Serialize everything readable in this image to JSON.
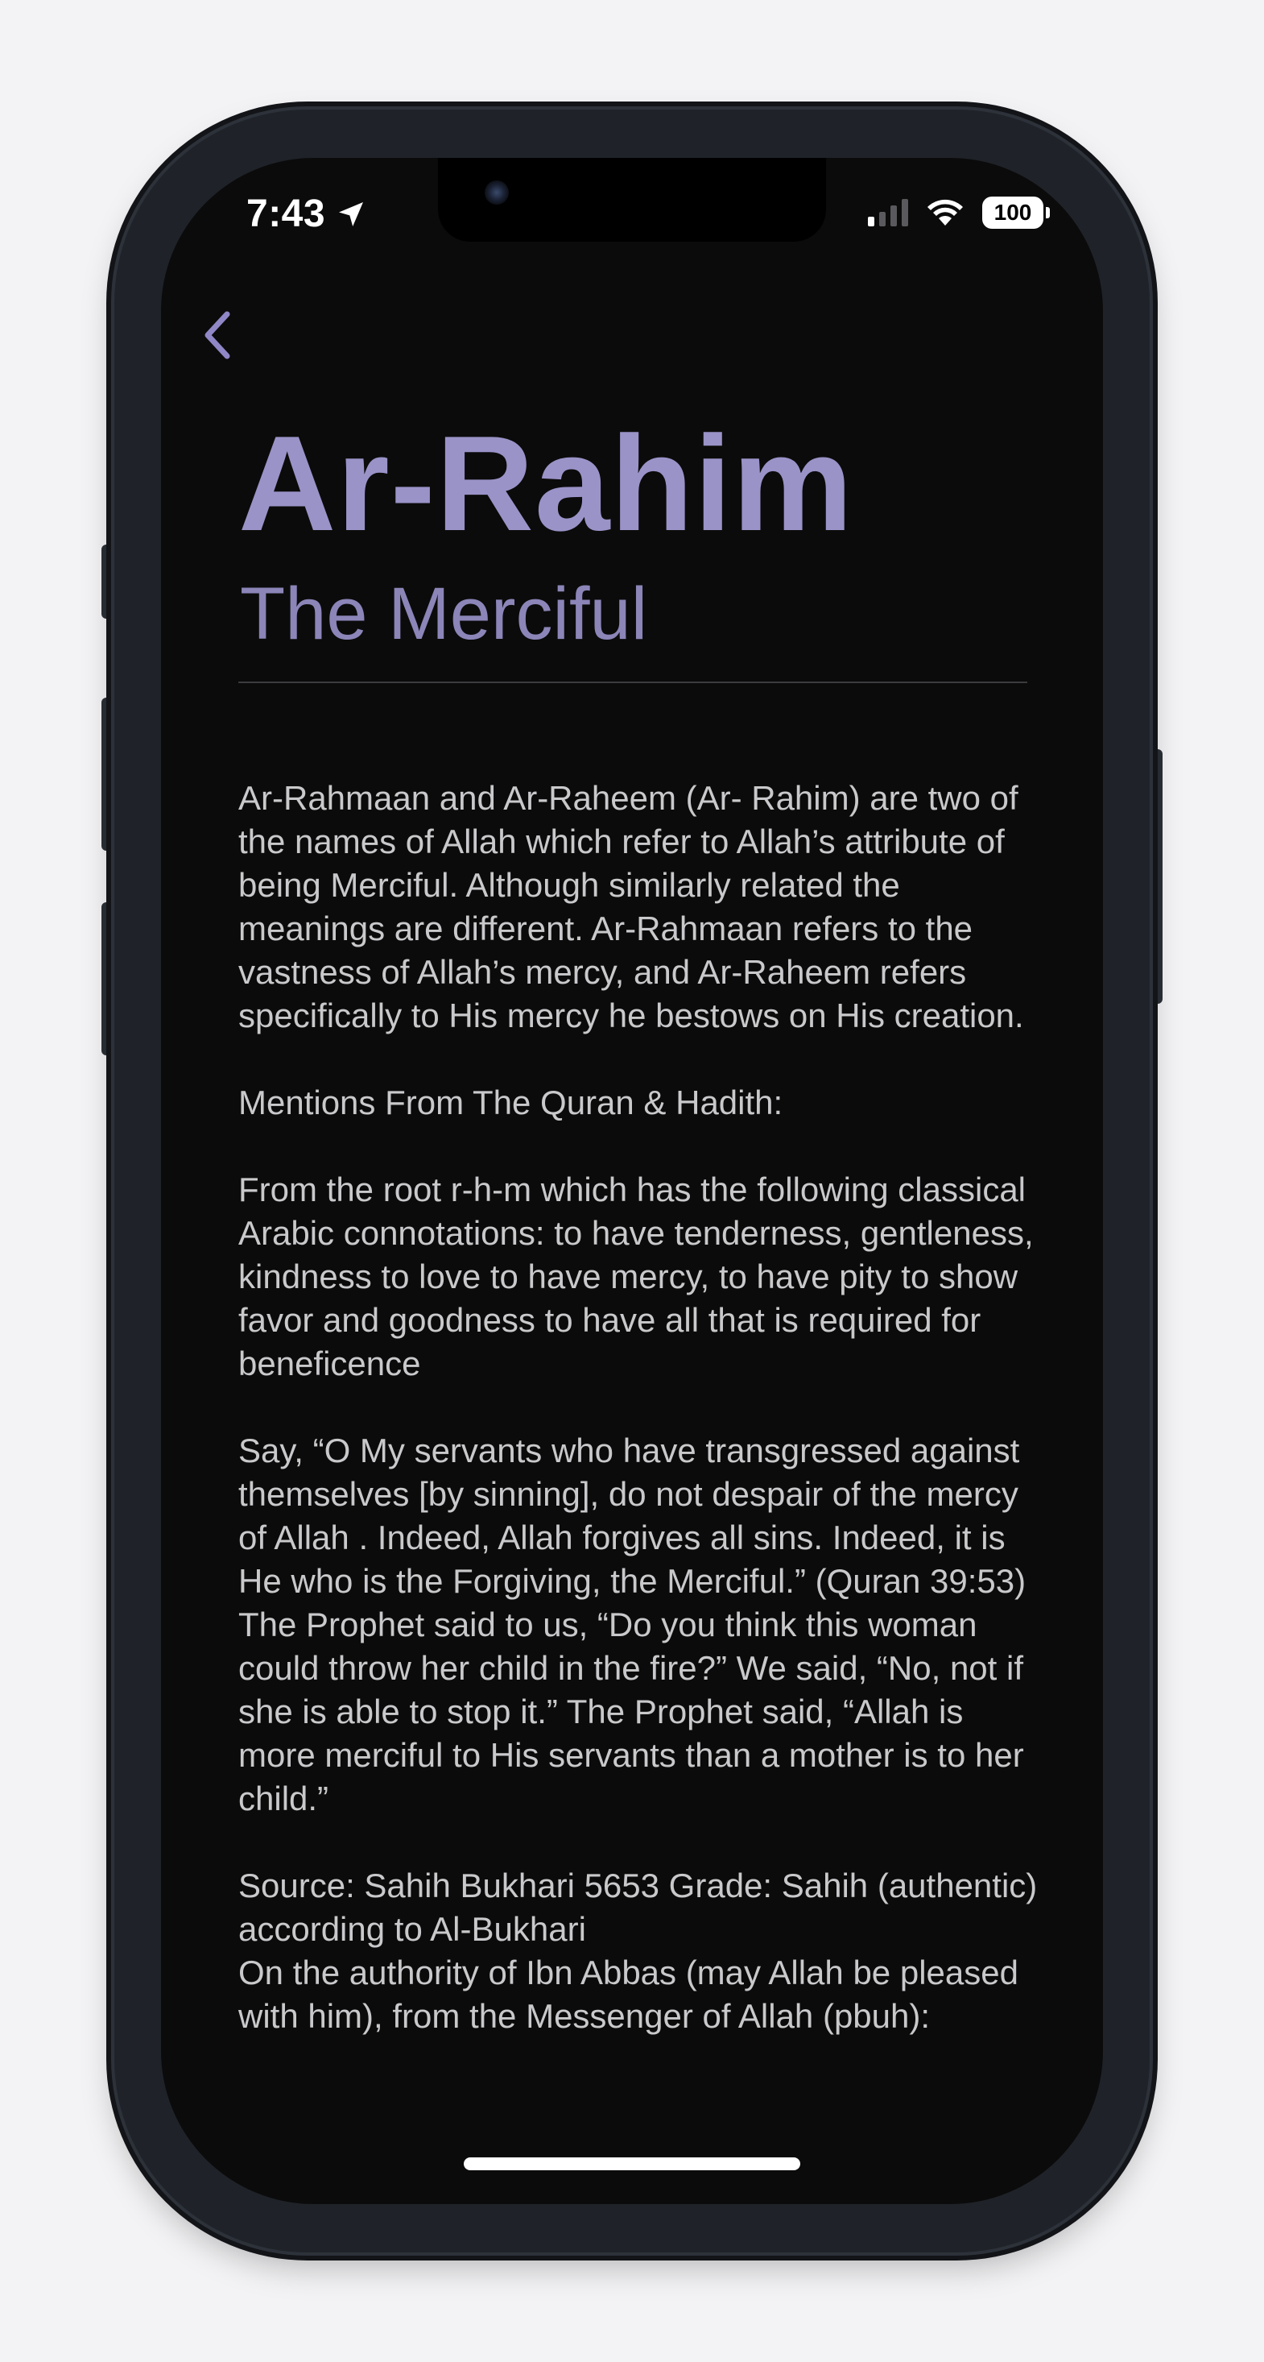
{
  "status_bar": {
    "time": "7:43",
    "battery": "100"
  },
  "icons": {
    "location": "location-arrow-icon",
    "signal": "cellular-signal-icon",
    "wifi": "wifi-icon",
    "back": "chevron-left-icon"
  },
  "colors": {
    "accent": "#9a93c8",
    "background": "#0b0b0b",
    "body_text": "#c9c9cc"
  },
  "page": {
    "title": "Ar-Rahim",
    "subtitle": "The Merciful",
    "paragraphs": [
      "Ar-Rahmaan and Ar-Raheem (Ar- Rahim) are two of the names of Allah which refer to Allah’s attribute of being Merciful. Although similarly related the meanings are different. Ar-Rahmaan refers to the vastness of Allah’s mercy, and Ar-Raheem refers specifically to His mercy he bestows on His creation.",
      "Mentions From The Quran & Hadith:",
      "From the root r-h-m which has the following classical Arabic connotations: to have tenderness, gentleness, kindness to love to have mercy, to have pity to show favor and goodness to have all that is required for beneficence",
      "Say, “O My servants who have transgressed against themselves [by sinning], do not despair of the mercy of Allah . Indeed, Allah forgives all sins. Indeed, it is He who is the Forgiving, the Merciful.” (Quran 39:53)\nThe Prophet said to us, “Do you think this woman could throw her child in the fire?” We said, “No, not if she is able to stop it.” The Prophet said, “Allah is more merciful to His servants than a mother is to her child.”",
      "Source: Sahih Bukhari 5653 Grade: Sahih (authentic) according to Al-Bukhari\nOn the authority of Ibn Abbas (may Allah be pleased with him), from the Messenger of Allah (pbuh):"
    ]
  }
}
